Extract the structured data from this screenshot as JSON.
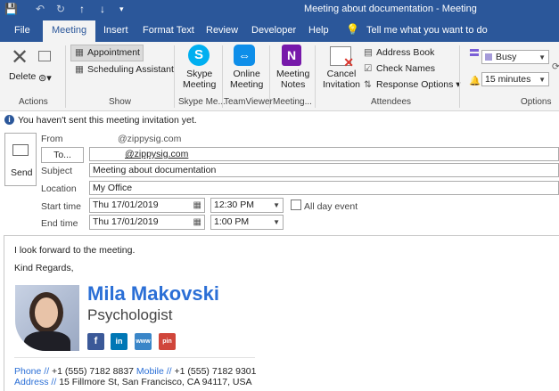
{
  "window": {
    "title": "Meeting about documentation  -  Meeting"
  },
  "tabs": [
    "File",
    "Meeting",
    "Insert",
    "Format Text",
    "Review",
    "Developer",
    "Help"
  ],
  "tell_me": "Tell me what you want to do",
  "ribbon": {
    "actions": {
      "delete": "Delete",
      "label": "Actions"
    },
    "show": {
      "appointment": "Appointment",
      "scheduling": "Scheduling Assistant",
      "label": "Show"
    },
    "skype": {
      "line1": "Skype",
      "line2": "Meeting",
      "label": "Skype Me..."
    },
    "teamviewer": {
      "line1": "Online",
      "line2": "Meeting",
      "label": "TeamViewer"
    },
    "notes": {
      "line1": "Meeting",
      "line2": "Notes",
      "label": "Meeting..."
    },
    "attendees": {
      "cancel1": "Cancel",
      "cancel2": "Invitation",
      "address_book": "Address Book",
      "check_names": "Check Names",
      "response": "Response Options",
      "label": "Attendees"
    },
    "options": {
      "busy": "Busy",
      "reminder": "15 minutes",
      "label": "Options"
    }
  },
  "info_text": "You haven't sent this meeting invitation yet.",
  "form": {
    "send": "Send",
    "from_label": "From",
    "from_value": "@zippysig.com",
    "to_button": "To...",
    "to_value": "@zippysig.com",
    "subject_label": "Subject",
    "subject_value": "Meeting about documentation",
    "location_label": "Location",
    "location_value": "My Office",
    "start_label": "Start time",
    "start_date": "Thu 17/01/2019",
    "start_time": "12:30 PM",
    "all_day": "All day event",
    "end_label": "End time",
    "end_date": "Thu 17/01/2019",
    "end_time": "1:00 PM"
  },
  "body": {
    "line1": "I look forward to the meeting.",
    "line2": "Kind Regards,",
    "name": "Mila Makovski",
    "role": "Psychologist",
    "social": [
      "f",
      "in",
      "www",
      "pin"
    ],
    "phone_label": "Phone //",
    "phone_value": "+1 (555) 7182 8837",
    "mobile_label": "Mobile //",
    "mobile_value": "+1 (555) 7182 9301",
    "address_label": "Address //",
    "address_value": "15 Fillmore St, San Francisco, CA 94117, USA"
  },
  "colors": {
    "brand": "#2b579a",
    "accent": "#2b6fd6",
    "facebook": "#3b5998",
    "linkedin": "#0077b5",
    "web": "#3a86c8",
    "pin": "#d0463b"
  }
}
